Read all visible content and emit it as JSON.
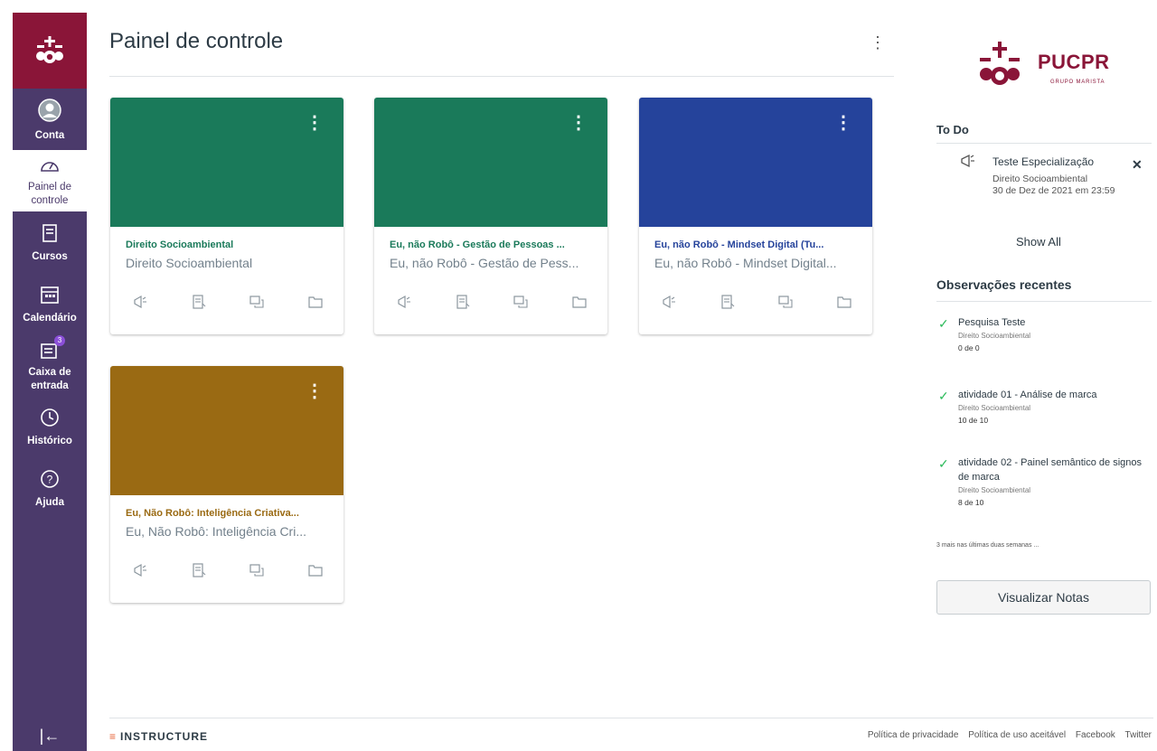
{
  "sidebar": {
    "items": [
      {
        "label": "Conta",
        "icon": "account-avatar-icon"
      },
      {
        "label": "Painel de controle",
        "icon": "dashboard-icon"
      },
      {
        "label": "Cursos",
        "icon": "courses-icon"
      },
      {
        "label": "Calendário",
        "icon": "calendar-icon"
      },
      {
        "label": "Caixa de entrada",
        "icon": "inbox-icon",
        "badge": "3"
      },
      {
        "label": "Histórico",
        "icon": "clock-icon"
      },
      {
        "label": "Ajuda",
        "icon": "help-icon"
      }
    ],
    "collapse_icon": "collapse-icon",
    "accent": "#8a1538",
    "background": "#4b3a6b"
  },
  "header": {
    "title": "Painel de controle"
  },
  "cards": [
    {
      "title": "Direito Socioambiental",
      "subtitle": "Direito Socioambiental",
      "color": "#1a7a5a"
    },
    {
      "title": "Eu, não Robô - Gestão de Pessoas ...",
      "subtitle": "Eu, não Robô - Gestão de Pess...",
      "color": "#1a7a5a"
    },
    {
      "title": "Eu, não Robô - Mindset Digital (Tu...",
      "subtitle": "Eu, não Robô - Mindset Digital...",
      "color": "#25439b"
    },
    {
      "title": "Eu, Não Robô: Inteligência Criativa...",
      "subtitle": "Eu, Não Robô: Inteligência Cri...",
      "color": "#9a6a13"
    }
  ],
  "brand": {
    "name": "PUCPR",
    "sub": "GRUPO MARISTA"
  },
  "todo": {
    "heading": "To Do",
    "item": {
      "title": "Teste Especialização",
      "course": "Direito Socioambiental",
      "due": "30 de Dez de 2021 em 23:59"
    },
    "show_all": "Show All"
  },
  "observations": {
    "heading": "Observações recentes",
    "items": [
      {
        "title": "Pesquisa Teste",
        "course": "Direito Socioambiental",
        "score": "0 de 0"
      },
      {
        "title": "atividade 01 - Análise de marca",
        "course": "Direito Socioambiental",
        "score": "10 de 10"
      },
      {
        "title": "atividade 02 - Painel semântico de signos de marca",
        "course": "Direito Socioambiental",
        "score": "8 de 10"
      }
    ],
    "more": "3 mais nas últimas duas semanas ...",
    "view_grades": "Visualizar Notas"
  },
  "footer": {
    "logo": "INSTRUCTURE",
    "links": [
      "Política de privacidade",
      "Política de uso aceitável",
      "Facebook",
      "Twitter"
    ]
  }
}
